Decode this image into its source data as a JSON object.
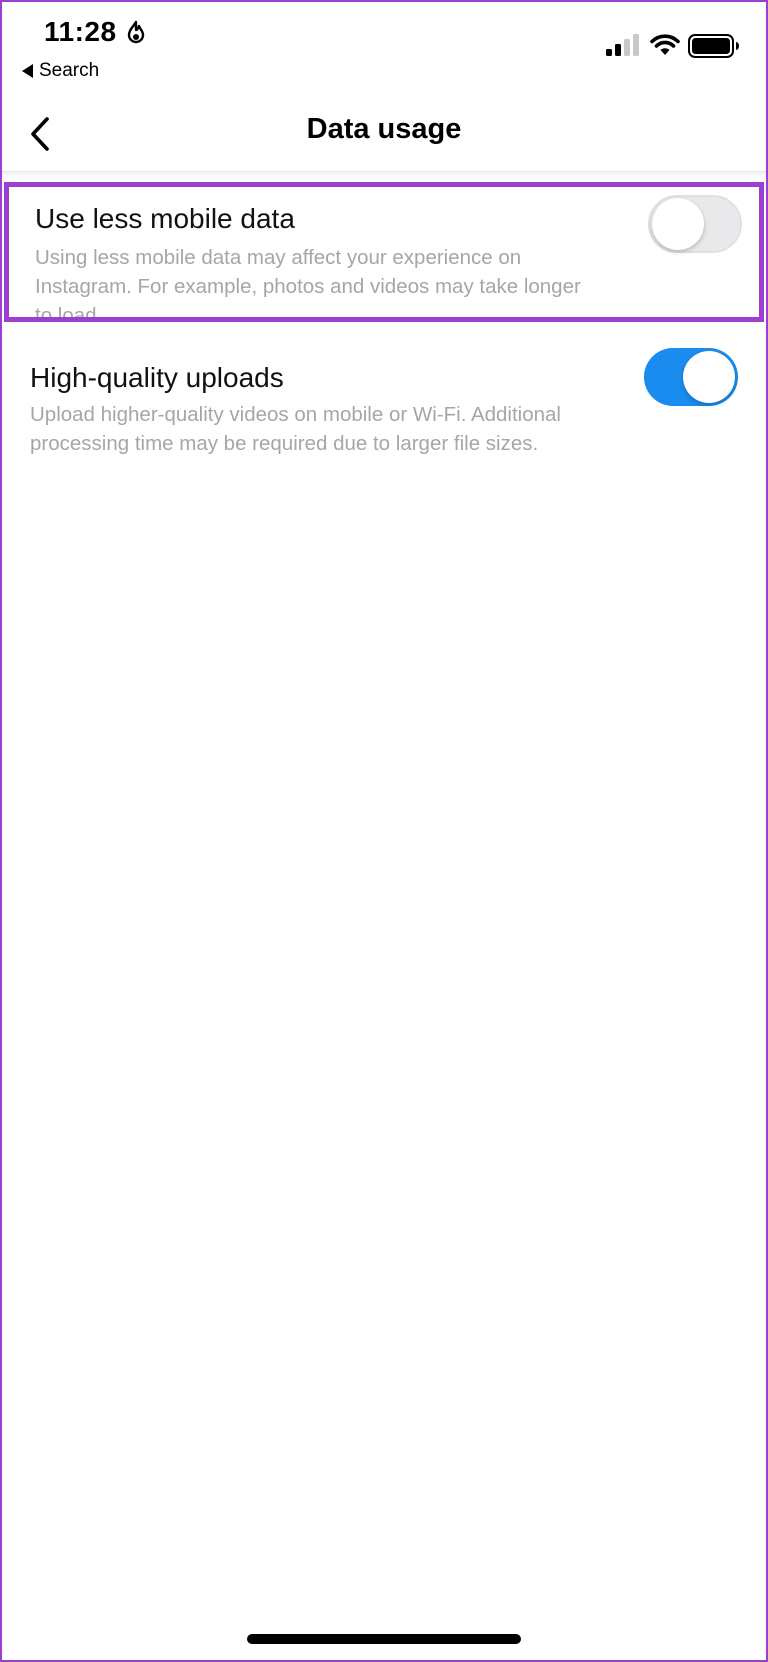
{
  "status_bar": {
    "time": "11:28",
    "back_app_label": "Search",
    "icons": [
      "focus-mode-icon",
      "cellular-signal-icon",
      "wifi-icon",
      "battery-icon"
    ]
  },
  "nav": {
    "title": "Data usage",
    "back_icon": "chevron-left-icon"
  },
  "settings": [
    {
      "title": "Use less mobile data",
      "description": "Using less mobile data may affect your experience on Instagram. For example, photos and videos may take longer to load.",
      "enabled": false
    },
    {
      "title": "High-quality uploads",
      "description": "Upload higher-quality videos on mobile or Wi-Fi. Additional processing time may be required due to larger file sizes.",
      "enabled": true
    }
  ],
  "colors": {
    "highlight": "#9b3fcf",
    "toggle_on": "#1a8cf0",
    "toggle_off": "#e9e9eb",
    "description_text": "#a6a6a6"
  }
}
